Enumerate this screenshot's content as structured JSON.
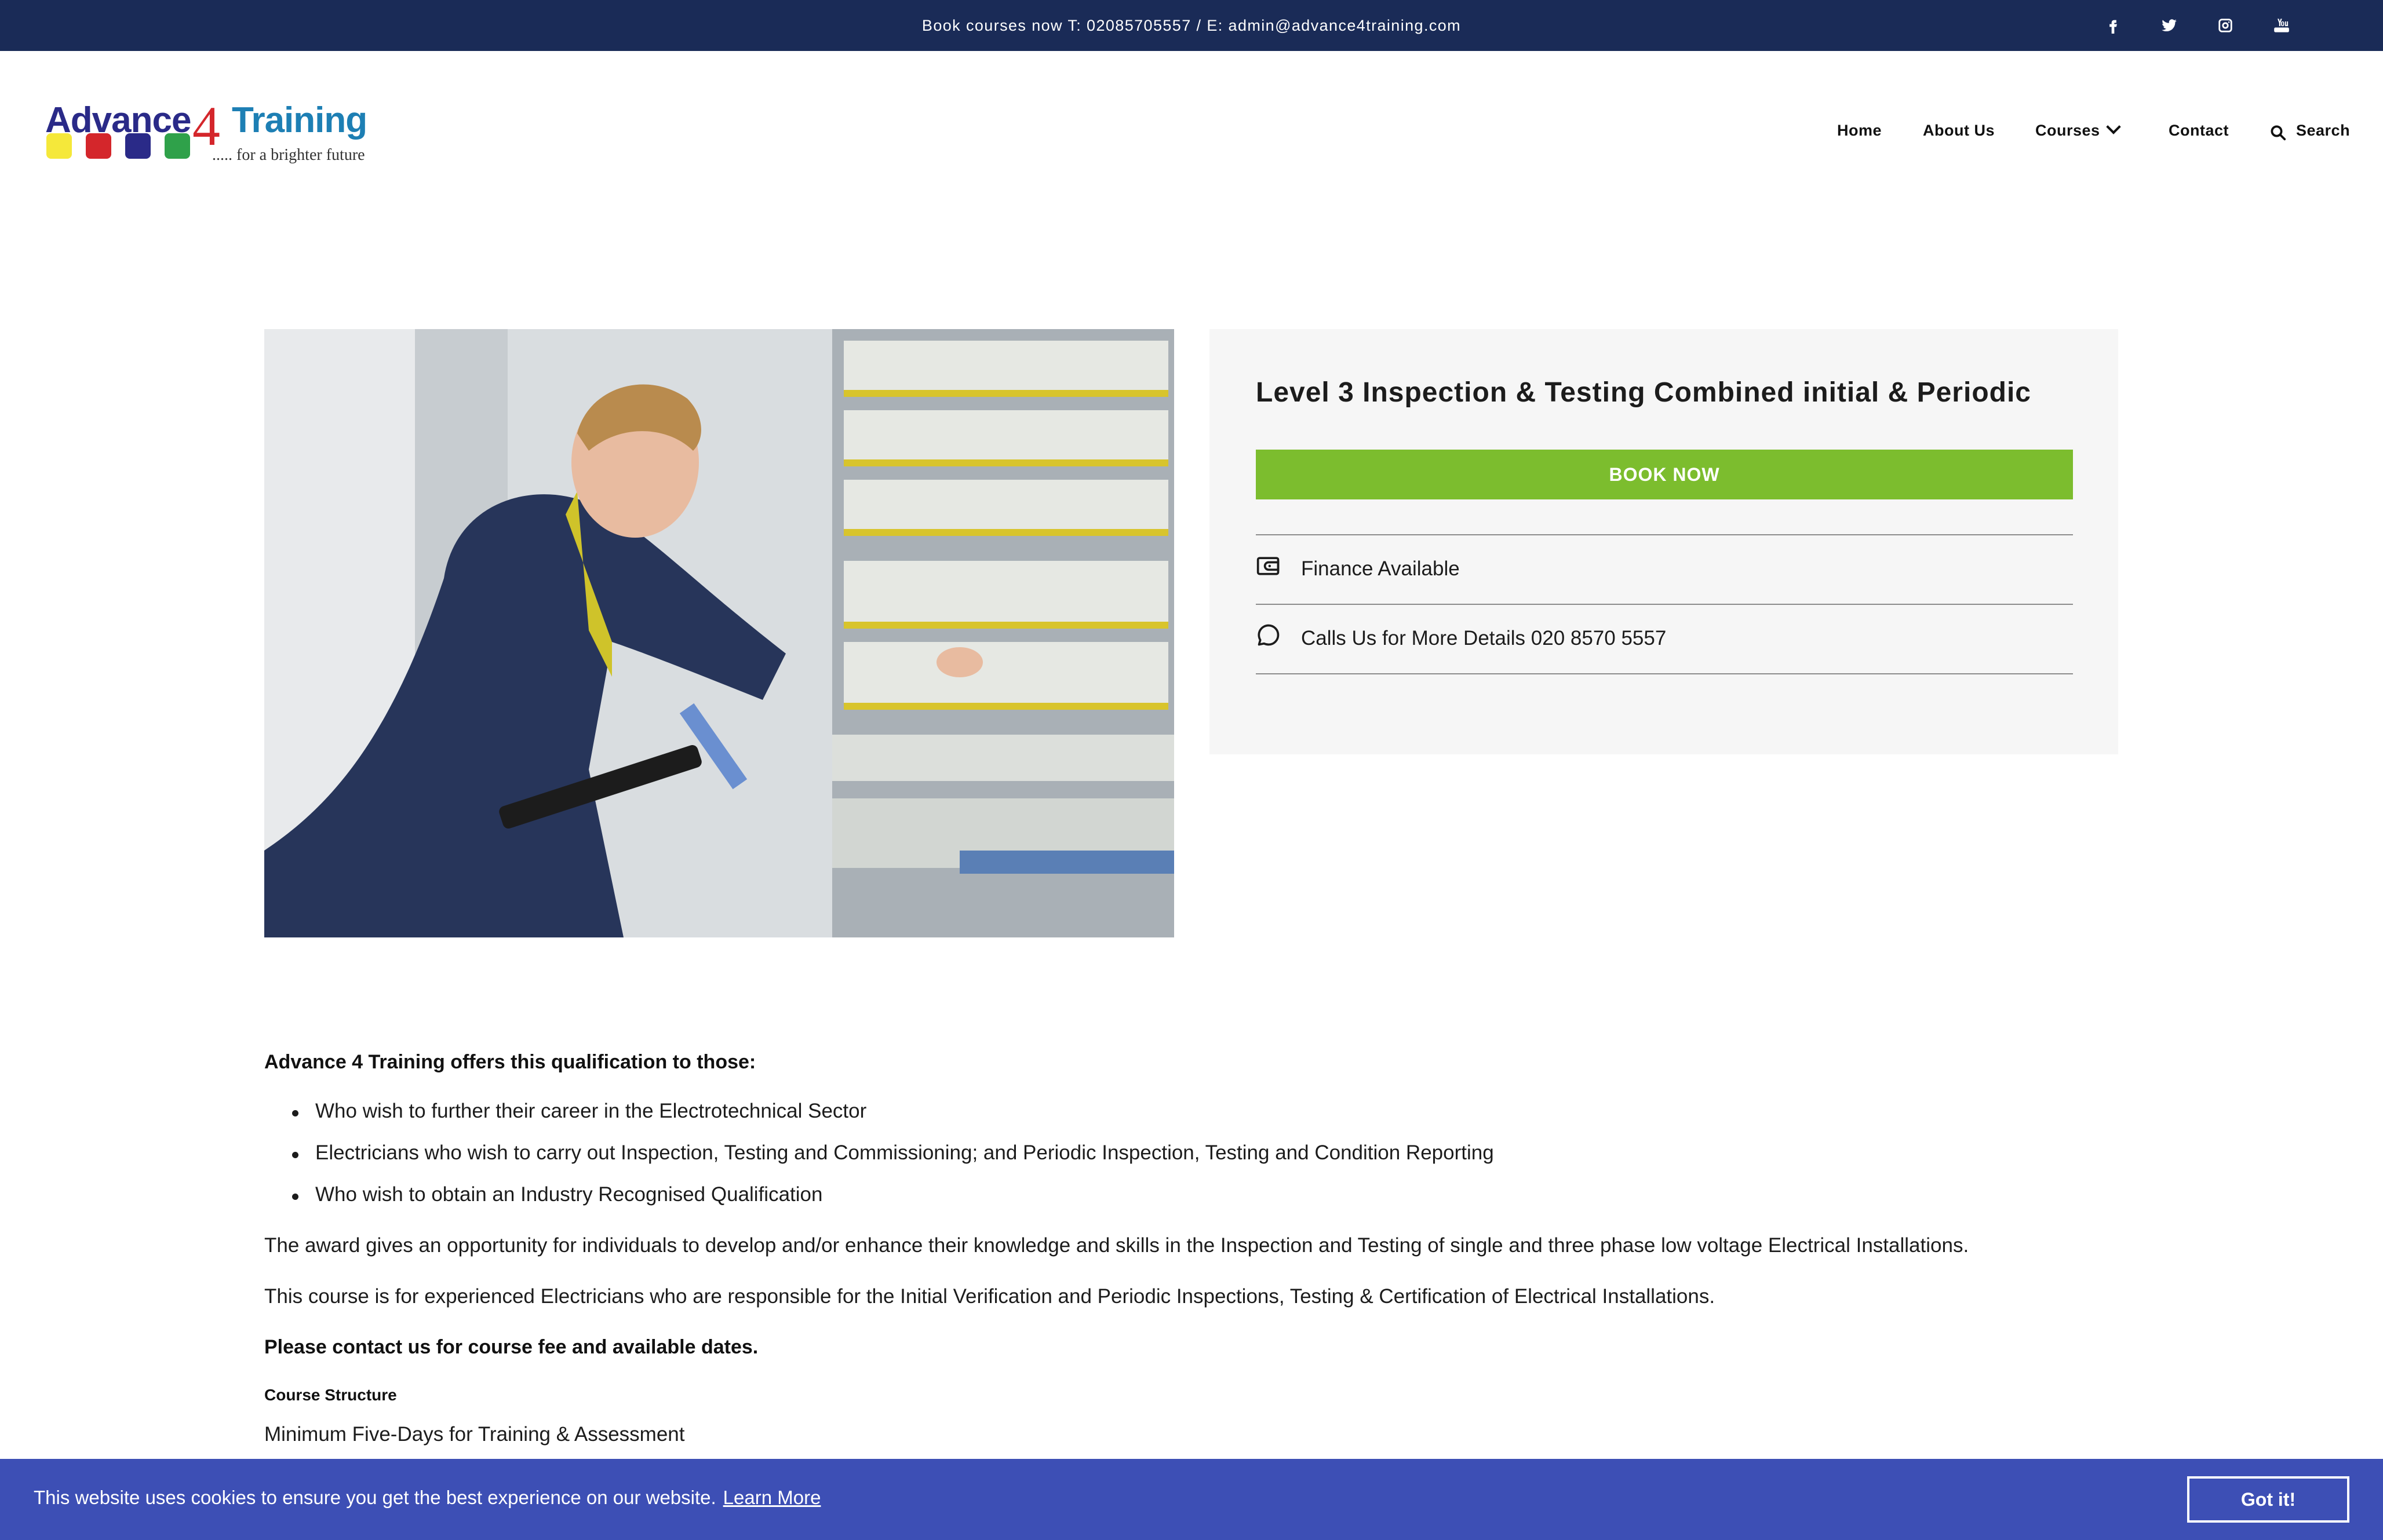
{
  "topbar": {
    "text": "Book courses now T: 02085705557 / E: admin@advance4training.com",
    "social": [
      "facebook-icon",
      "twitter-icon",
      "instagram-icon",
      "youtube-icon"
    ]
  },
  "logo": {
    "word_a": "Advance",
    "word_4": "4",
    "word_t": "Training",
    "tagline": "..... for a brighter future",
    "square_colors": [
      "#f5e83a",
      "#d4262b",
      "#2a2a88",
      "#2fa14a"
    ]
  },
  "nav": {
    "home": "Home",
    "about": "About Us",
    "courses": "Courses",
    "contact": "Contact",
    "search": "Search"
  },
  "course": {
    "title": "Level 3 Inspection & Testing Combined initial & Periodic",
    "book_label": "BOOK NOW",
    "finance": "Finance Available",
    "calls": "Calls Us for More Details 020 8570 5557"
  },
  "content": {
    "intro": "Advance 4 Training offers this qualification to those:",
    "bullets": [
      "Who wish to further their career in the Electrotechnical Sector",
      "Electricians who wish to carry out Inspection, Testing and Commissioning; and Periodic Inspection, Testing and Condition Reporting",
      "Who wish to obtain an Industry Recognised Qualification"
    ],
    "para1": "The award gives an opportunity for individuals to develop and/or enhance their knowledge and skills in the Inspection and Testing of single and three phase low voltage Electrical Installations.",
    "para2": "This course is for experienced Electricians who are responsible for the Initial Verification and Periodic Inspections, Testing & Certification of Electrical Installations.",
    "contact_note": "Please contact us for course fee and available dates.",
    "structure_heading": "Course Structure",
    "structure_text": "Minimum Five-Days for Training & Assessment"
  },
  "cookie": {
    "text": "This website uses cookies to ensure you get the best experience on our website.",
    "link": "Learn More",
    "button": "Got it!"
  },
  "colors": {
    "topbar": "#1a2b57",
    "book_button": "#7cbd2e",
    "cookie_bar": "#3d4fb5",
    "card_bg": "#f6f6f6"
  }
}
